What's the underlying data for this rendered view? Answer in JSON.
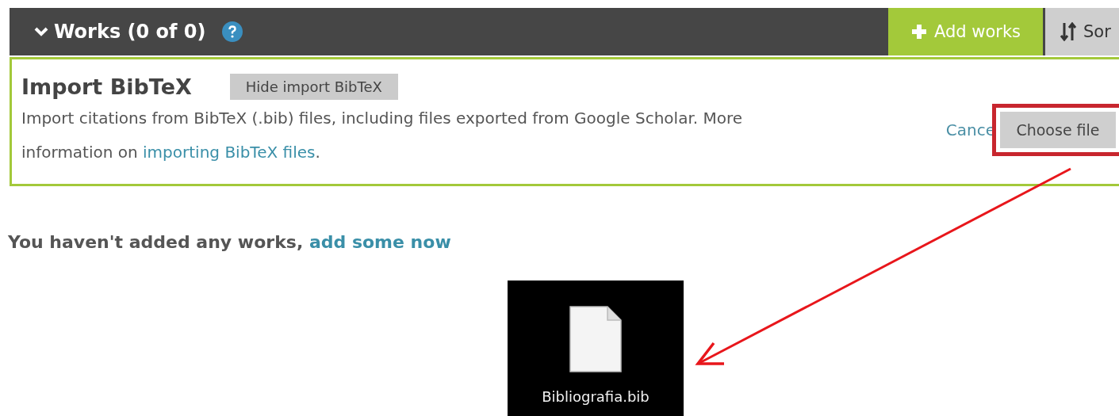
{
  "header": {
    "title": "Works (0 of 0)",
    "expanded": true
  },
  "toolbar": [
    {
      "label": "Add works",
      "kind": "add"
    },
    {
      "label": "Sor",
      "kind": "sort"
    }
  ],
  "import_panel": {
    "title": "Import BibTeX",
    "hide_button": "Hide import BibTeX",
    "description": "Import citations from BibTeX (.bib) files, including files exported from Google Scholar. More information on ",
    "link": "importing BibTeX files",
    "after_link": ".",
    "cancel": "Cance",
    "choose_button": "Choose file"
  },
  "empty_message": {
    "text": "You haven't added any works, ",
    "link": "add some now"
  },
  "file": {
    "name": "Bibliografia.bib"
  }
}
